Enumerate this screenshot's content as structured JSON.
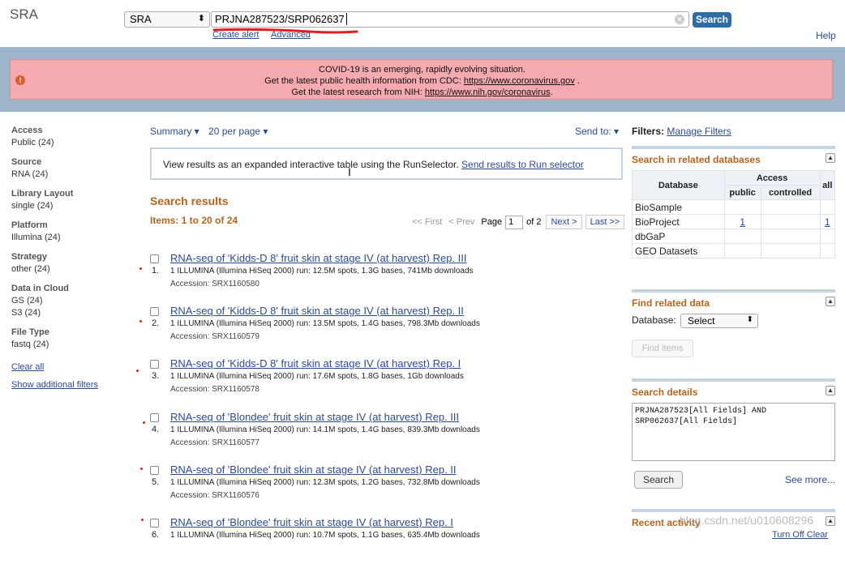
{
  "header": {
    "logo": "SRA",
    "db_selected": "SRA",
    "search_value": "PRJNA287523/SRP062637",
    "search_button": "Search",
    "create_alert": "Create alert",
    "advanced": "Advanced",
    "help": "Help"
  },
  "banner": {
    "line1": "COVID-19 is an emerging, rapidly evolving situation.",
    "line2_text": "Get the latest public health information from CDC: ",
    "line2_link": "https://www.coronavirus.gov",
    "line2_end": " .",
    "line3_text": "Get the latest research from NIH: ",
    "line3_link": "https://www.nih.gov/coronavirus",
    "line3_end": "."
  },
  "sidebar": {
    "facets": [
      {
        "title": "Access",
        "values": [
          "Public (24)"
        ]
      },
      {
        "title": "Source",
        "values": [
          "RNA (24)"
        ]
      },
      {
        "title": "Library Layout",
        "values": [
          "single (24)"
        ]
      },
      {
        "title": "Platform",
        "values": [
          "Illumina (24)"
        ]
      },
      {
        "title": "Strategy",
        "values": [
          "other (24)"
        ]
      },
      {
        "title": "Data in Cloud",
        "values": [
          "GS (24)",
          "S3 (24)"
        ]
      },
      {
        "title": "File Type",
        "values": [
          "fastq (24)"
        ]
      }
    ],
    "clear_all": "Clear all",
    "show_filters": "Show additional filters"
  },
  "toolbar": {
    "summary": "Summary ▾",
    "per_page": "20 per page ▾",
    "send_to": "Send to: ▾"
  },
  "runselector": {
    "text": "View results as an expanded interactive table using the RunSelector. ",
    "link": "Send results to Run selector"
  },
  "results": {
    "heading": "Search results",
    "items_count": "Items: 1 to 20 of 24",
    "pager": {
      "first": "<< First",
      "prev": "< Prev",
      "page_label": "Page",
      "page_value": "1",
      "of": "of 2",
      "next": "Next >",
      "last": "Last >>"
    },
    "items": [
      {
        "num": "1.",
        "title": "RNA-seq of 'Kidds-D 8' fruit skin at stage IV (at harvest) Rep. III",
        "desc": "1 ILLUMINA (Illumina HiSeq 2000) run: 12.5M spots, 1.3G bases, 741Mb downloads",
        "acc": "Accession: SRX1160580"
      },
      {
        "num": "2.",
        "title": "RNA-seq of 'Kidds-D 8' fruit skin at stage IV (at harvest) Rep. II",
        "desc": "1 ILLUMINA (Illumina HiSeq 2000) run: 13.5M spots, 1.4G bases, 798.3Mb downloads",
        "acc": "Accession: SRX1160579"
      },
      {
        "num": "3.",
        "title": "RNA-seq of 'Kidds-D 8' fruit skin at stage IV (at harvest) Rep. I",
        "desc": "1 ILLUMINA (Illumina HiSeq 2000) run: 17.6M spots, 1.8G bases, 1Gb downloads",
        "acc": "Accession: SRX1160578"
      },
      {
        "num": "4.",
        "title": "RNA-seq of 'Blondee' fruit skin at stage IV (at harvest) Rep. III",
        "desc": "1 ILLUMINA (Illumina HiSeq 2000) run: 14.1M spots, 1.4G bases, 839.3Mb downloads",
        "acc": "Accession: SRX1160577"
      },
      {
        "num": "5.",
        "title": "RNA-seq of 'Blondee' fruit skin at stage IV (at harvest) Rep. II",
        "desc": "1 ILLUMINA (Illumina HiSeq 2000) run: 12.3M spots, 1.2G bases, 732.8Mb downloads",
        "acc": "Accession: SRX1160576"
      },
      {
        "num": "6.",
        "title": "RNA-seq of 'Blondee' fruit skin at stage IV (at harvest) Rep. I",
        "desc": "1 ILLUMINA (Illumina HiSeq 2000) run: 10.7M spots, 1.1G bases, 635.4Mb downloads",
        "acc": ""
      }
    ]
  },
  "right": {
    "filters_label": "Filters: ",
    "manage_filters": "Manage Filters",
    "related_title": "Search in related databases",
    "table": {
      "h_database": "Database",
      "h_access": "Access",
      "h_public": "public",
      "h_controlled": "controlled",
      "h_all": "all",
      "rows": [
        {
          "db": "BioSample",
          "public": "",
          "controlled": "",
          "all": ""
        },
        {
          "db": "BioProject",
          "public": "1",
          "controlled": "",
          "all": "1"
        },
        {
          "db": "dbGaP",
          "public": "",
          "controlled": "",
          "all": ""
        },
        {
          "db": "GEO Datasets",
          "public": "",
          "controlled": "",
          "all": ""
        }
      ]
    },
    "find_title": "Find related data",
    "database_label": "Database:",
    "database_selected": "Select",
    "find_items": "Find items",
    "details_title": "Search details",
    "details_text": "PRJNA287523[All Fields] AND\nSRP062637[All Fields]",
    "details_search": "Search",
    "see_more": "See more...",
    "recent_title": "Recent activity",
    "turn_off": "Turn Off   Clear"
  },
  "watermark": "blog.csdn.net/u010608296",
  "colors": {
    "accent": "#b5651d",
    "link": "#2a4a9a",
    "banner": "#f4aab0",
    "banner_frame": "#9db5ca",
    "search_btn": "#2e6ca8"
  }
}
